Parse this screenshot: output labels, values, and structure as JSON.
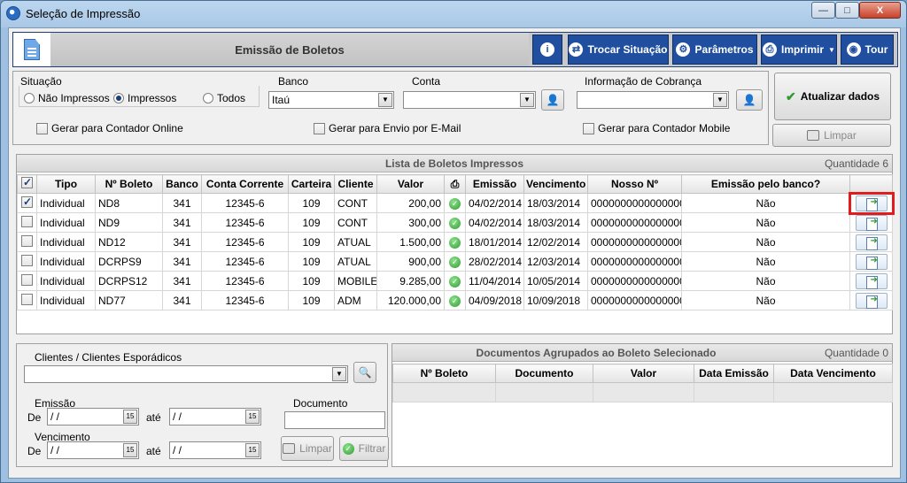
{
  "window": {
    "title": "Seleção de Impressão",
    "minimize": "—",
    "maximize": "□",
    "close": "X"
  },
  "header": {
    "title": "Emissão de Boletos",
    "info_icon": "i",
    "trocar": "Trocar Situação",
    "parametros": "Parâmetros",
    "imprimir": "Imprimir",
    "tour": "Tour"
  },
  "filters": {
    "situacao_label": "Situação",
    "nao_impressos": "Não Impressos",
    "impressos": "Impressos",
    "todos": "Todos",
    "banco_label": "Banco",
    "banco_value": "Itaú",
    "conta_label": "Conta",
    "conta_value": "",
    "info_cobranca_label": "Informação de Cobrança",
    "info_cobranca_value": "",
    "contador_online": "Gerar para Contador Online",
    "envio_email": "Gerar para Envio por E-Mail",
    "contador_mobile": "Gerar para Contador Mobile",
    "atualizar": "Atualizar dados",
    "limpar": "Limpar"
  },
  "grid": {
    "caption": "Lista de Boletos Impressos",
    "quantidade": "Quantidade 6",
    "columns": [
      "Tipo",
      "Nº Boleto",
      "Banco",
      "Conta Corrente",
      "Carteira",
      "Cliente",
      "Valor",
      "Emissão",
      "Vencimento",
      "Nosso Nº",
      "Emissão pelo banco?"
    ],
    "rows": [
      {
        "tipo": "Individual",
        "boleto": "ND8",
        "banco": "341",
        "conta": "12345-6",
        "carteira": "109",
        "cliente": "CONT",
        "valor": "200,00",
        "emissao": "04/02/2014",
        "venc": "18/03/2014",
        "nosso": "0000000000000000",
        "emissao_banco": "Não"
      },
      {
        "tipo": "Individual",
        "boleto": "ND9",
        "banco": "341",
        "conta": "12345-6",
        "carteira": "109",
        "cliente": "CONT",
        "valor": "300,00",
        "emissao": "04/02/2014",
        "venc": "18/03/2014",
        "nosso": "0000000000000000",
        "emissao_banco": "Não"
      },
      {
        "tipo": "Individual",
        "boleto": "ND12",
        "banco": "341",
        "conta": "12345-6",
        "carteira": "109",
        "cliente": "ATUAL",
        "valor": "1.500,00",
        "emissao": "18/01/2014",
        "venc": "12/02/2014",
        "nosso": "0000000000000000",
        "emissao_banco": "Não"
      },
      {
        "tipo": "Individual",
        "boleto": "DCRPS9",
        "banco": "341",
        "conta": "12345-6",
        "carteira": "109",
        "cliente": "ATUAL",
        "valor": "900,00",
        "emissao": "28/02/2014",
        "venc": "12/03/2014",
        "nosso": "0000000000000000",
        "emissao_banco": "Não"
      },
      {
        "tipo": "Individual",
        "boleto": "DCRPS12",
        "banco": "341",
        "conta": "12345-6",
        "carteira": "109",
        "cliente": "MOBILE",
        "valor": "9.285,00",
        "emissao": "11/04/2014",
        "venc": "10/05/2014",
        "nosso": "0000000000000000",
        "emissao_banco": "Não"
      },
      {
        "tipo": "Individual",
        "boleto": "ND77",
        "banco": "341",
        "conta": "12345-6",
        "carteira": "109",
        "cliente": "ADM",
        "valor": "120.000,00",
        "emissao": "04/09/2018",
        "venc": "10/09/2018",
        "nosso": "0000000000000000",
        "emissao_banco": "Não"
      }
    ]
  },
  "bottom": {
    "clientes_label": "Clientes / Clientes Esporádicos",
    "emissao_label": "Emissão",
    "vencimento_label": "Vencimento",
    "de": "De",
    "ate": "até",
    "date_placeholder": " / /",
    "cal": "15",
    "documento_label": "Documento",
    "limpar": "Limpar",
    "filtrar": "Filtrar",
    "doc_caption": "Documentos Agrupados ao Boleto Selecionado",
    "doc_quantidade": "Quantidade 0",
    "doc_columns": [
      "Nº Boleto",
      "Documento",
      "Valor",
      "Data Emissão",
      "Data Vencimento"
    ]
  }
}
